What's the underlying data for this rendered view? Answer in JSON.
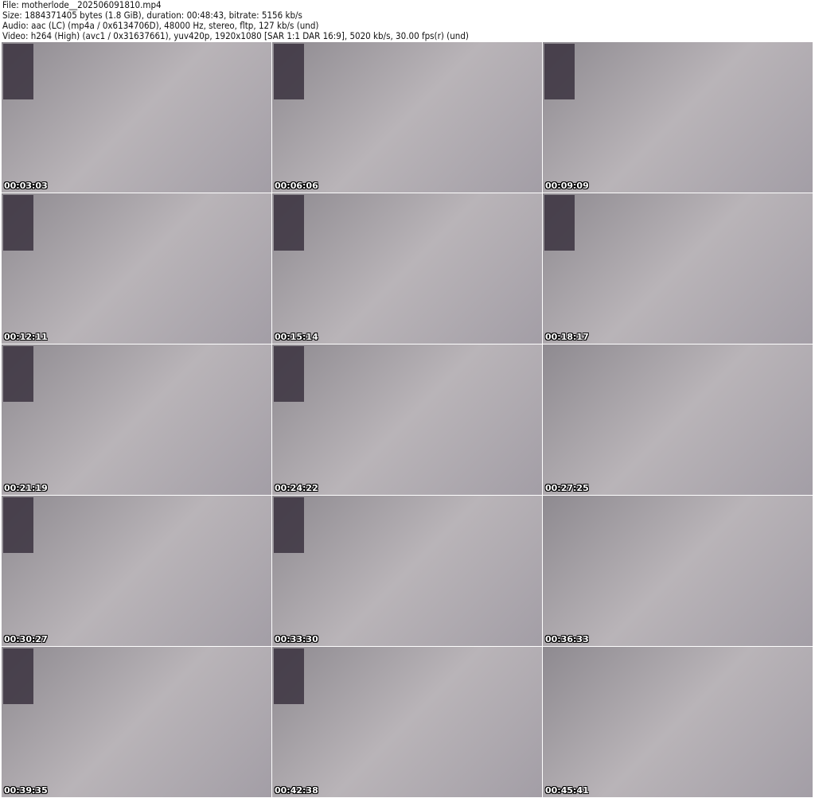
{
  "header": {
    "file": "File: motherlode__202506091810.mp4",
    "size": "Size: 1884371405 bytes (1.8 GiB), duration: 00:48:43, bitrate: 5156 kb/s",
    "audio": "Audio: aac (LC) (mp4a / 0x6134706D), 48000 Hz, stereo, fltp, 127 kb/s (und)",
    "video": "Video: h264 (High) (avc1 / 0x31637661), yuv420p, 1920x1080 [SAR 1:1 DAR 16:9], 5020 kb/s, 30.00 fps(r) (und)"
  },
  "frames": [
    "00:03:03",
    "00:06:06",
    "00:09:09",
    "00:12:11",
    "00:15:14",
    "00:18:17",
    "00:21:19",
    "00:24:22",
    "00:27:25",
    "00:30:27",
    "00:33:30",
    "00:36:33",
    "00:39:35",
    "00:42:38",
    "00:45:41"
  ]
}
